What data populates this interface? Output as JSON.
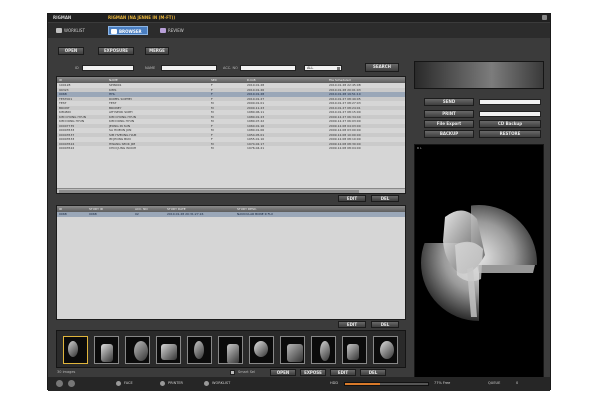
{
  "title": {
    "app": "RIGMAN",
    "patient": "RIGMAN (NA JENNE IN (M-FT))"
  },
  "tabs": [
    {
      "label": "WORKLIST",
      "active": false
    },
    {
      "label": "BROWSER",
      "active": true
    },
    {
      "label": "REVIEW",
      "active": false
    }
  ],
  "toolbar": {
    "open": "OPEN",
    "exposure": "EXPOSURE",
    "merge": "MERGE"
  },
  "search": {
    "id_label": "ID",
    "name_label": "NAME",
    "acc_label": "ACC. NO",
    "date_value": "ALL",
    "search_button": "SEARCH"
  },
  "patients": {
    "columns": [
      "ID",
      "NAME",
      "SEX",
      "D.O.B",
      "File Scheduled"
    ],
    "rows": [
      [
        "100128",
        "SPIN001",
        "F",
        "2010.01.28",
        "2010.01.28 22:45:08"
      ],
      [
        "99323",
        "KIMS",
        "F",
        "2010.01.26",
        "2010.01.28 20:01:03"
      ],
      [
        "0068",
        "HHL",
        "F",
        "2010.01.28",
        "2010.01.28 19:51:10"
      ],
      [
        "TEST001",
        "ROMEL SOPHEI",
        "F",
        "2010.01.27",
        "2010.01.27 08:49:05"
      ],
      [
        "TEST",
        "TEST",
        "M",
        "2000.01.01",
        "2010.01.27 08:27:03"
      ],
      [
        "BRONT",
        "BRONEY",
        "M",
        "2000.11.23",
        "2010.01.27 08:24:01"
      ],
      [
        "KIM-BIN",
        "AHYSEOK SOPH",
        "M",
        "1980.06.11",
        "2010.01.27 08:15:00"
      ],
      [
        "KIM CHUNG HYUN",
        "KIM CHUNG HYUN",
        "M",
        "1980.01.23",
        "2009.12.27 06:34:40"
      ],
      [
        "KIM DONG HYUN",
        "KIM DONG HYUN",
        "M",
        "1980.07.22",
        "2009.12.27 06:03:00"
      ],
      [
        "00007735",
        "JEONG IN SUN",
        "F",
        "1960.01.16",
        "2009.12.08 04:03:00"
      ],
      [
        "00003533",
        "SA HOEON JUN",
        "M",
        "1980.01.06",
        "2009.12.08 03:00:00"
      ],
      [
        "00003537",
        "SIM HVEONG HAM",
        "F",
        "1954.05.01",
        "2009.12.08 10:00:00"
      ],
      [
        "00003533",
        "IM JEONG BUN",
        "F",
        "1955.01.10",
        "2009.12.08 08:10:00"
      ],
      [
        "00003524",
        "HWANG SEOK JIM",
        "M",
        "1974.02.17",
        "2009.12.08 08:30:00"
      ],
      [
        "00003522",
        "CHOI JUNG WOOH",
        "M",
        "1976.04.21",
        "2009.12.08 08:04:00"
      ]
    ],
    "selected_index": 2
  },
  "patients_actions": {
    "edit": "EDIT",
    "delete": "DEL"
  },
  "studies": {
    "columns": [
      "ID",
      "STUDY ID",
      "ACC. NO",
      "STUDY DATE",
      "STUDY DESC."
    ],
    "rows": [
      [
        "0068",
        "0068",
        "02",
        "2010.01.28 20:31:27.16",
        "NAVICULAR BONE R FLX"
      ]
    ],
    "selected_index": 0
  },
  "studies_actions": {
    "edit": "EDIT",
    "delete": "DEL"
  },
  "series_actions": {
    "edit": "EDIT",
    "delete": "DEL"
  },
  "right_panel": {
    "send": "SEND",
    "print": "PRINT",
    "file_export": "File Export",
    "cd_backup": "CD Backup",
    "backup": "BACKUP",
    "restore": "RESTORE"
  },
  "viewer": {
    "label": "R L"
  },
  "thumbnails": {
    "count_label": "30 images",
    "check_label": "Smart Sel",
    "count": 11,
    "active_index": 0
  },
  "thumb_actions": {
    "open": "OPEN",
    "expose": "EXPOSE",
    "edit": "EDIT",
    "delete": "DEL"
  },
  "status": {
    "face": "FACE",
    "printer": "PRINTER",
    "worklist": "WORKLIST",
    "hdd_label": "HDD",
    "hdd_used_fraction": 0.42,
    "hdd_text": "77% Free",
    "queue_label": "QUEUE",
    "queue_value": "0"
  },
  "colors": {
    "accent": "#4a7ec0",
    "selection": "#9aa7b8",
    "progress": "#d97a2a",
    "thumb_active": "#e0b53c"
  }
}
